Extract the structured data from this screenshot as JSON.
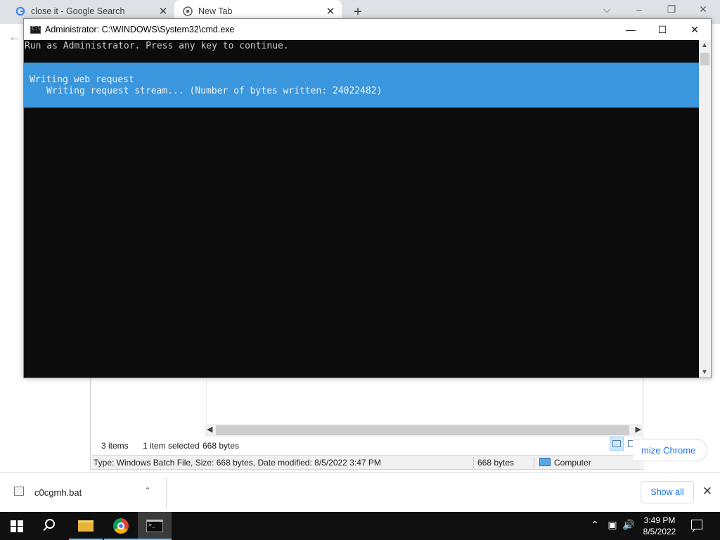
{
  "browser": {
    "tabs": [
      {
        "title": "close it - Google Search",
        "favicon": "google-g-icon"
      },
      {
        "title": "New Tab",
        "favicon": "chrome-icon"
      }
    ],
    "new_tab_glyph": "+",
    "customize_label": "mize Chrome"
  },
  "cmd": {
    "title": "Administrator: C:\\WINDOWS\\System32\\cmd.exe",
    "console_line": "Run as Administrator. Press any key to continue.",
    "progress_activity": "Writing web request",
    "progress_status": "Writing request stream... (Number of bytes written: 24022482)",
    "colors": {
      "console_bg": "#0c0c0c",
      "console_fg": "#cccccc",
      "progress_bg": "#3a96dd"
    }
  },
  "explorer": {
    "item_count": "3 items",
    "selection": "1 item selected",
    "selection_size": "668 bytes",
    "details_text": "Type: Windows Batch File, Size: 668 bytes, Date modified: 8/5/2022 3:47 PM",
    "details_size": "668 bytes",
    "location": "Computer"
  },
  "downloads": {
    "file_name": "c0cgmh.bat",
    "show_all_label": "Show all"
  },
  "taskbar": {
    "time": "3:49 PM",
    "date": "8/5/2022",
    "accent": "#76b9ed"
  }
}
